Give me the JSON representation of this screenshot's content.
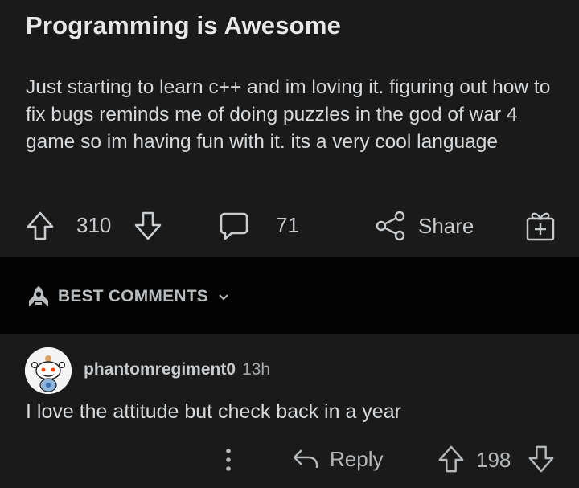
{
  "post": {
    "title": "Programming is Awesome",
    "body": "Just starting to learn c++ and im loving it. figuring out how to fix bugs reminds me of doing puzzles in the god of war 4 game so im having fun with it. its a very cool language",
    "votes": "310",
    "comments_count": "71",
    "share_label": "Share"
  },
  "comments_header": {
    "sort_label": "BEST COMMENTS"
  },
  "comment": {
    "author": "phantomregiment0",
    "time": "13h",
    "text": "I love the attitude but check back in a year",
    "reply_label": "Reply",
    "votes": "198"
  },
  "icons": {
    "upvote": "arrow-up-icon",
    "downvote": "arrow-down-icon",
    "comments": "speech-bubble-icon",
    "share": "share-nodes-icon",
    "award": "gift-icon",
    "sort": "rocket-icon",
    "chevron": "chevron-down-icon",
    "more": "more-vertical-icon",
    "reply": "reply-arrow-icon"
  },
  "colors": {
    "background": "#0b0b0b",
    "card": "#1a1a1b",
    "text": "#d7dadc",
    "muted": "#a8abad"
  }
}
